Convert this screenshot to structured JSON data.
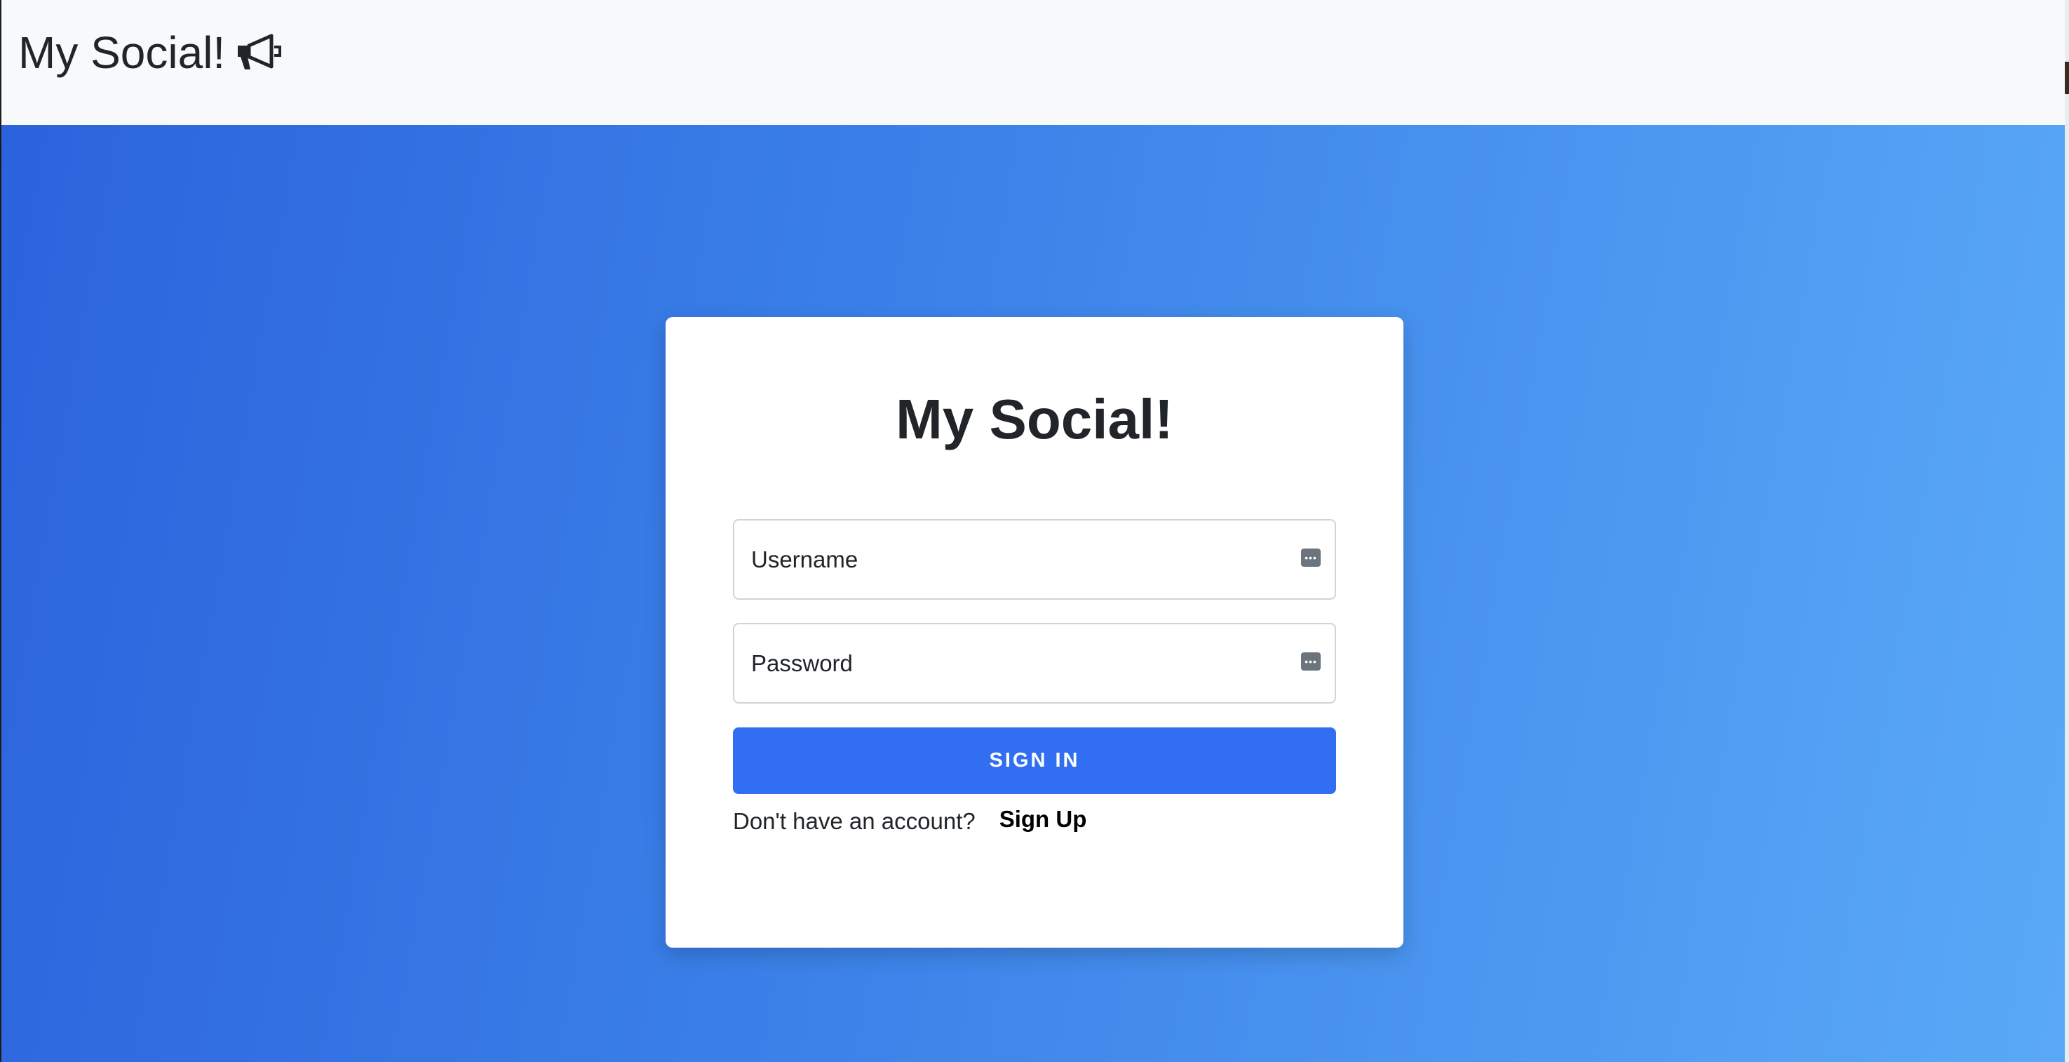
{
  "navbar": {
    "brand": "My Social!",
    "brand_icon": "megaphone-icon"
  },
  "login": {
    "title": "My Social!",
    "username_placeholder": "Username",
    "password_placeholder": "Password",
    "field_icon": "password-manager-key-icon",
    "signin_label": "SIGN IN",
    "no_account_text": "Don't have an account?",
    "signup_label": "Sign Up"
  },
  "colors": {
    "navbar_bg": "#f8f9fa",
    "gradient_start": "#2c63dd",
    "gradient_end": "#5aa9f7",
    "button_bg": "#316ef1",
    "text": "#212529"
  }
}
